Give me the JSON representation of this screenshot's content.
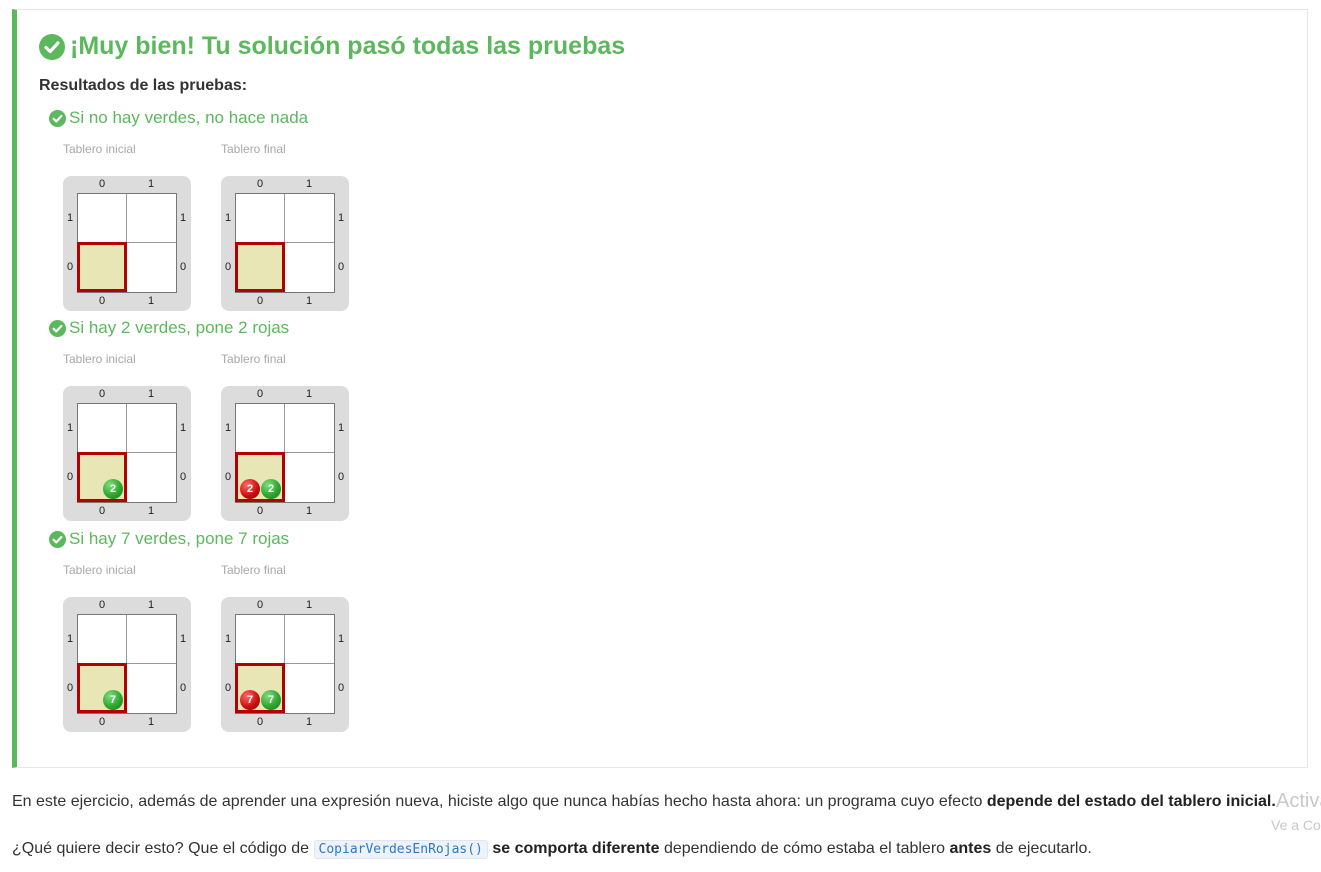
{
  "result": {
    "title": "¡Muy bien! Tu solución pasó todas las pruebas",
    "results_label": "Resultados de las pruebas:",
    "tests": [
      {
        "name": "Si no hay verdes, no hace nada",
        "initial_caption": "Tablero inicial",
        "final_caption": "Tablero final",
        "initial_board": {
          "columns": [
            "0",
            "1"
          ],
          "rows": [
            "1",
            "0"
          ],
          "head": "0,0",
          "balls": []
        },
        "final_board": {
          "columns": [
            "0",
            "1"
          ],
          "rows": [
            "1",
            "0"
          ],
          "head": "0,0",
          "balls": []
        }
      },
      {
        "name": "Si hay 2 verdes, pone 2 rojas",
        "initial_caption": "Tablero inicial",
        "final_caption": "Tablero final",
        "initial_board": {
          "columns": [
            "0",
            "1"
          ],
          "rows": [
            "1",
            "0"
          ],
          "head": "0,0",
          "balls": [
            {
              "color": "green",
              "count": "2"
            }
          ]
        },
        "final_board": {
          "columns": [
            "0",
            "1"
          ],
          "rows": [
            "1",
            "0"
          ],
          "head": "0,0",
          "balls": [
            {
              "color": "red",
              "count": "2"
            },
            {
              "color": "green",
              "count": "2"
            }
          ]
        }
      },
      {
        "name": "Si hay 7 verdes, pone 7 rojas",
        "initial_caption": "Tablero inicial",
        "final_caption": "Tablero final",
        "initial_board": {
          "columns": [
            "0",
            "1"
          ],
          "rows": [
            "1",
            "0"
          ],
          "head": "0,0",
          "balls": [
            {
              "color": "green",
              "count": "7"
            }
          ]
        },
        "final_board": {
          "columns": [
            "0",
            "1"
          ],
          "rows": [
            "1",
            "0"
          ],
          "head": "0,0",
          "balls": [
            {
              "color": "red",
              "count": "7"
            },
            {
              "color": "green",
              "count": "7"
            }
          ]
        }
      }
    ]
  },
  "explanation": {
    "p1_text": "En este ejercicio, además de aprender una expresión nueva, hiciste algo que nunca habías hecho hasta ahora: un programa cuyo efecto ",
    "p1_bold": "depende del estado del tablero inicial",
    "p1_end": ".",
    "p2_start": "¿Qué quiere decir esto? Que el código de ",
    "p2_code": "CopiarVerdesEnRojas()",
    "p2_bold1": "se comporta diferente",
    "p2_mid": " dependiendo de cómo estaba el tablero ",
    "p2_bold2": "antes",
    "p2_end": " de ejecutarlo."
  },
  "watermark": {
    "line1": "Activa",
    "line2": "Ve a Co"
  },
  "colors": {
    "success": "#5cb85c",
    "head_border": "#b30000",
    "head_fill": "#e8e6b4",
    "green_ball": "#2fa52f",
    "red_ball": "#cc1111"
  },
  "icons": {
    "success": "check-circle-icon"
  }
}
